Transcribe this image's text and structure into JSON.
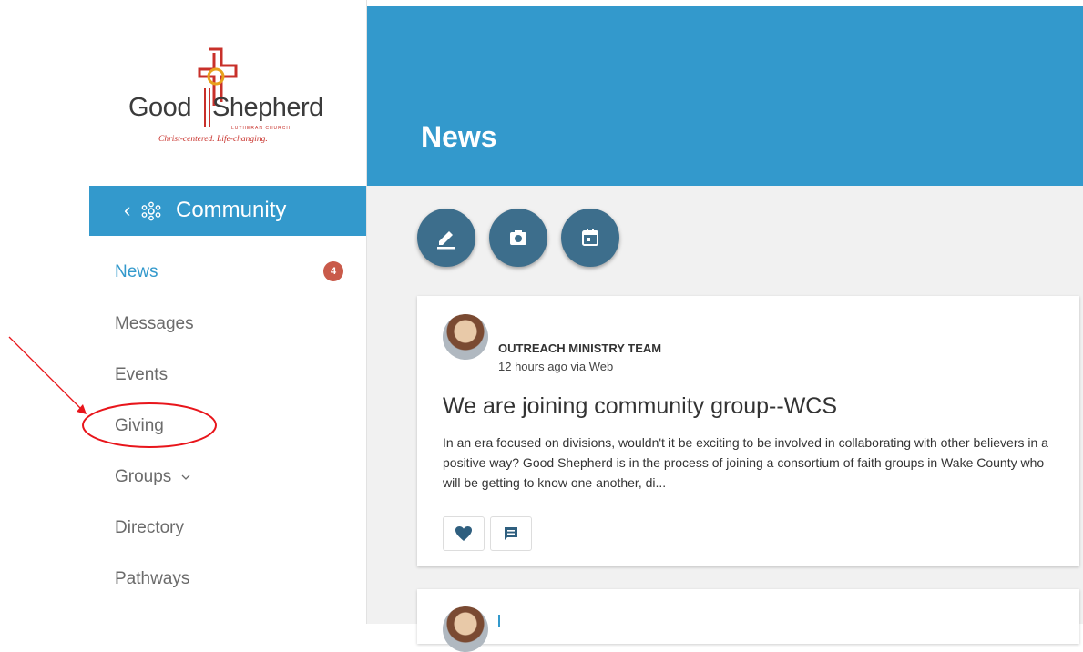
{
  "logo": {
    "word_left": "Good",
    "word_right": "Shepherd",
    "subtitle": "LUTHERAN CHURCH",
    "tagline": "Christ-centered. Life-changing."
  },
  "sidebar": {
    "section": {
      "back_icon": "chevron-left-icon",
      "icon": "community-icon",
      "label": "Community"
    },
    "items": [
      {
        "label": "News",
        "active": true,
        "badge": "4"
      },
      {
        "label": "Messages"
      },
      {
        "label": "Events"
      },
      {
        "label": "Giving"
      },
      {
        "label": "Groups",
        "icon": "chevron-down-icon"
      },
      {
        "label": "Directory"
      },
      {
        "label": "Pathways"
      }
    ]
  },
  "header": {
    "title": "News"
  },
  "actions": [
    {
      "icon": "pencil-icon"
    },
    {
      "icon": "camera-icon"
    },
    {
      "icon": "calendar-icon"
    }
  ],
  "posts": [
    {
      "author": "OUTREACH MINISTRY TEAM",
      "time": "12 hours ago via Web",
      "title": "We are joining community group--WCS",
      "body": "In an era focused on divisions, wouldn't it be exciting to be involved in collaborating with other believers in a positive way? Good Shepherd is in the process of joining a consortium of faith groups in Wake County who will be getting to know one another, di...",
      "buttons": [
        {
          "icon": "heart-icon"
        },
        {
          "icon": "comment-icon"
        }
      ]
    },
    {
      "author": ""
    }
  ],
  "colors": {
    "primary": "#3399cc",
    "fab": "#3d6e8c",
    "badge": "#c95a4a",
    "annotation": "#e8151b"
  }
}
